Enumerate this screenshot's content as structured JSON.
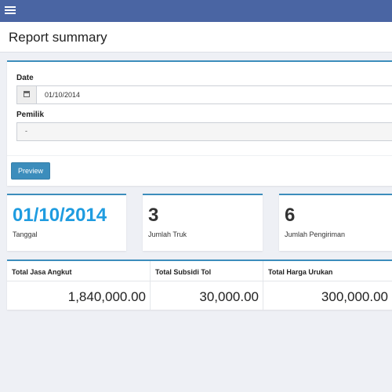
{
  "header": {
    "menu_icon": "hamburger-icon",
    "bg_color": "#4a65a3"
  },
  "page": {
    "title": "Report summary"
  },
  "filter": {
    "date_label": "Date",
    "date_value": "01/10/2014",
    "calendar_icon": "calendar-icon",
    "owner_label": "Pemilik",
    "owner_value": "-",
    "preview_label": "Preview"
  },
  "stats": [
    {
      "value": "01/10/2014",
      "label": "Tanggal"
    },
    {
      "value": "3",
      "label": "Jumlah Truk"
    },
    {
      "value": "6",
      "label": "Jumlah Pengiriman"
    }
  ],
  "totals": [
    {
      "header": "Total Jasa Angkut",
      "value": "1,840,000.00"
    },
    {
      "header": "Total Subsidi Tol",
      "value": "30,000.00"
    },
    {
      "header": "Total Harga Urukan",
      "value": "300,000.00"
    }
  ],
  "colors": {
    "accent": "#3c8dbc",
    "highlight": "#1f9ce0"
  }
}
